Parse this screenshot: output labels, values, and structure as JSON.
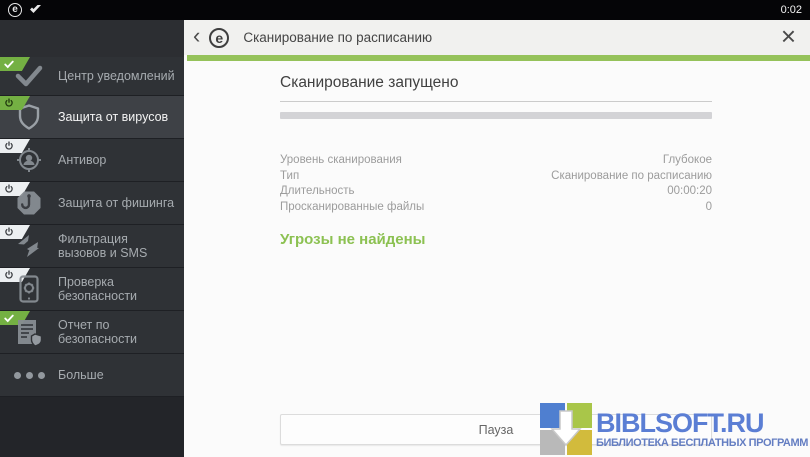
{
  "status_bar": {
    "time": "0:02",
    "icons": [
      "eset-logo-icon",
      "check-flag-icon"
    ]
  },
  "header": {
    "title": "Сканирование по расписанию",
    "back_icon": "chevron-left",
    "logo": "e",
    "close_icon": "x"
  },
  "sidebar": {
    "items": [
      {
        "label": "Центр уведомлений",
        "badge": "check-green",
        "icon": "checkmark",
        "selected": false
      },
      {
        "label": "Защита от вирусов",
        "badge": "power-green",
        "icon": "shield",
        "selected": true
      },
      {
        "label": "Антивор",
        "badge": "power-white",
        "icon": "target-person",
        "selected": false
      },
      {
        "label": "Защита от фишинга",
        "badge": "power-white",
        "icon": "octagon-hook",
        "selected": false
      },
      {
        "label": "Фильтрация вызовов и SMS",
        "badge": "power-white",
        "icon": "call-arrows",
        "selected": false
      },
      {
        "label": "Проверка безопасности",
        "badge": "power-white",
        "icon": "phone-gear",
        "selected": false
      },
      {
        "label": "Отчет по безопасности",
        "badge": "check-green",
        "icon": "report-shield",
        "selected": false
      },
      {
        "label": "Больше",
        "badge": "none",
        "icon": "three-dots",
        "selected": false
      }
    ]
  },
  "main": {
    "title": "Сканирование запущено",
    "details": [
      {
        "label": "Уровень сканирования",
        "value": "Глубокое"
      },
      {
        "label": "Тип",
        "value": "Сканирование по расписанию"
      },
      {
        "label": "Длительность",
        "value": "00:00:20"
      },
      {
        "label": "Просканированные файлы",
        "value": "0"
      }
    ],
    "status_message": "Угрозы не найдены",
    "pause_button": "Пауза"
  },
  "watermark": {
    "title": "BIBLSOFT.RU",
    "subtitle": "БИБЛИОТЕКА БЕСПЛАТНЫХ ПРОГРАММ"
  },
  "colors": {
    "accent_green": "#95c25a",
    "badge_green": "#74b043",
    "status_message_green": "#8cc152",
    "sidebar_bg": "#2f3236",
    "sidebar_selected_bg": "#3e4146",
    "watermark_blue": "#5b7ed4"
  }
}
